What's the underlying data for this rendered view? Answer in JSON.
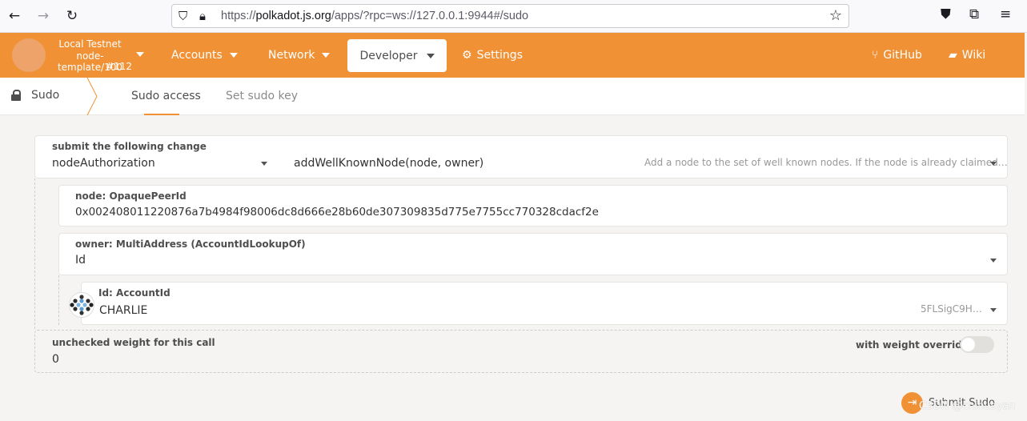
{
  "browser": {
    "url_prefix": "https://",
    "url_domain": "polkadot.js.org",
    "url_path": "/apps/?rpc=ws://127.0.0.1:9944#/sudo"
  },
  "header": {
    "chain_line1": "Local Testnet",
    "chain_line2": "node-template/100",
    "chain_line3": "#112",
    "menu": {
      "accounts": "Accounts",
      "network": "Network",
      "developer": "Developer",
      "settings": "Settings",
      "github": "GitHub",
      "wiki": "Wiki"
    }
  },
  "subnav": {
    "section": "Sudo",
    "tabs": [
      "Sudo access",
      "Set sudo key"
    ]
  },
  "form": {
    "submit_label": "submit the following change",
    "pallet": "nodeAuthorization",
    "call": "addWellKnownNode(node, owner)",
    "call_description": "Add a node to the set of well known nodes. If the node is already claimed…",
    "node_label": "node: OpaquePeerId",
    "node_value": "0x002408011220876a7b4984f98006dc8d666e28b60de307309835d775e7755cc770328cdacf2e",
    "owner_label": "owner: MultiAddress (AccountIdLookupOf)",
    "owner_value": "Id",
    "id_label": "Id: AccountId",
    "id_value": "CHARLIE",
    "id_address": "5FLSigC9H…",
    "weight_label": "unchecked weight for this call",
    "weight_value": "0",
    "override_label": "with weight override"
  },
  "actions": {
    "submit": "Submit Sudo"
  },
  "watermark": "CSDN @chinusyan",
  "colors": {
    "accent": "#f19135"
  }
}
